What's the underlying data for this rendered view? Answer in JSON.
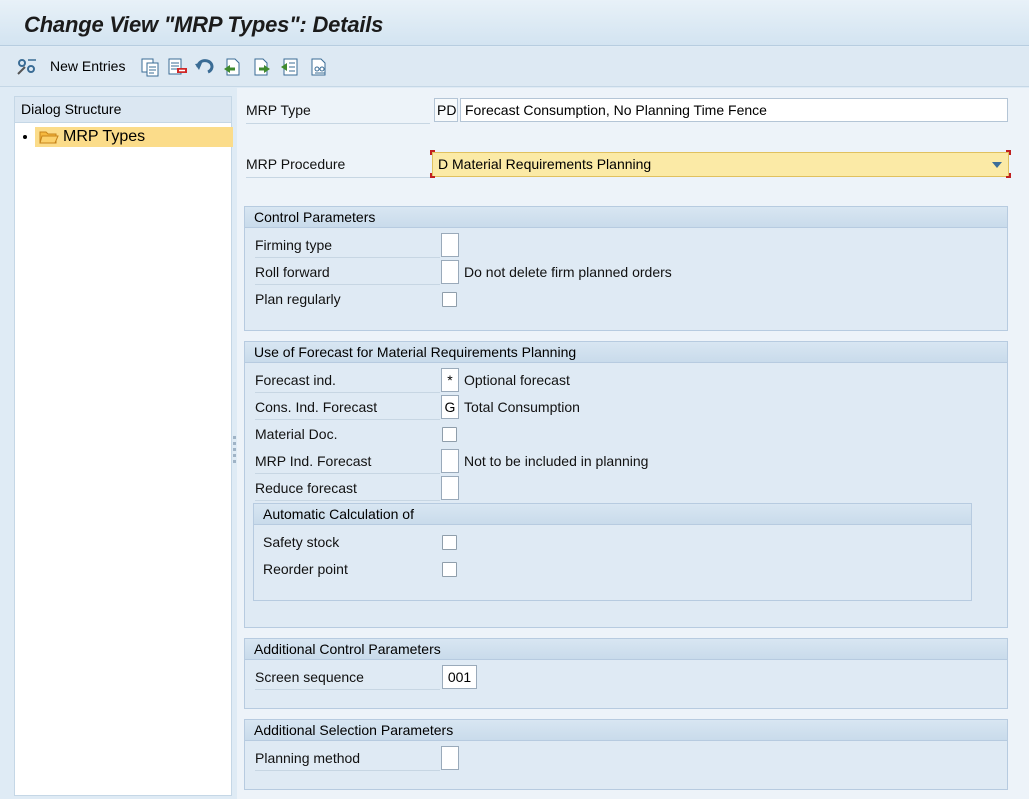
{
  "window": {
    "title": "Change View \"MRP Types\": Details"
  },
  "toolbar": {
    "new_entries_label": "New Entries",
    "icons": [
      "display-change-icon",
      "copy-icon",
      "delete-icon",
      "undo-icon",
      "previous-entry-icon",
      "next-entry-icon",
      "select-all-icon",
      "print-icon"
    ]
  },
  "dialog_structure": {
    "title": "Dialog Structure",
    "items": [
      {
        "label": "MRP Types",
        "icon": "folder-open-icon",
        "selected": true
      }
    ]
  },
  "header": {
    "mrp_type": {
      "label": "MRP Type",
      "key": "PD",
      "description": "Forecast Consumption, No Planning Time Fence"
    },
    "mrp_procedure": {
      "label": "MRP Procedure",
      "value": "D Material Requirements Planning"
    }
  },
  "control_parameters": {
    "title": "Control Parameters",
    "firming_type": {
      "label": "Firming type",
      "value": ""
    },
    "roll_forward": {
      "label": "Roll forward",
      "value": "",
      "text": "Do not delete firm planned orders"
    },
    "plan_regularly": {
      "label": "Plan regularly",
      "checked": false
    }
  },
  "forecast": {
    "title": "Use of Forecast for Material Requirements Planning",
    "forecast_ind": {
      "label": "Forecast ind.",
      "value": "*",
      "text": "Optional forecast"
    },
    "cons_ind_forecast": {
      "label": "Cons. Ind. Forecast",
      "value": "G",
      "text": "Total Consumption"
    },
    "material_doc": {
      "label": "Material Doc.",
      "checked": false
    },
    "mrp_ind_forecast": {
      "label": "MRP Ind. Forecast",
      "value": "",
      "text": "Not to be included in planning"
    },
    "reduce_forecast": {
      "label": "Reduce forecast",
      "value": ""
    },
    "auto_calc": {
      "title": "Automatic Calculation of",
      "safety_stock": {
        "label": "Safety stock",
        "checked": false
      },
      "reorder_point": {
        "label": "Reorder point",
        "checked": false
      }
    }
  },
  "additional_control": {
    "title": "Additional Control Parameters",
    "screen_sequence": {
      "label": "Screen sequence",
      "value": "001"
    }
  },
  "additional_selection": {
    "title": "Additional Selection Parameters",
    "planning_method": {
      "label": "Planning method",
      "value": ""
    }
  },
  "colors": {
    "selection": "#fbdc8a",
    "dropdown": "#fbeaa6",
    "background": "#dfebf5"
  }
}
